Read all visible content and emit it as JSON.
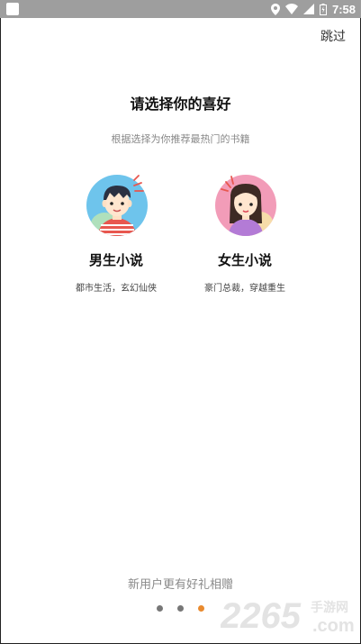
{
  "status_bar": {
    "time": "7:58"
  },
  "header": {
    "skip_label": "跳过"
  },
  "main": {
    "title": "请选择你的喜好",
    "subtitle": "根据选择为你推荐最热门的书籍",
    "options": [
      {
        "label": "男生小说",
        "tags": "都市生活，玄幻仙侠",
        "icon": "male-avatar-icon"
      },
      {
        "label": "女生小说",
        "tags": "豪门总裁，穿越重生",
        "icon": "female-avatar-icon"
      }
    ]
  },
  "footer": {
    "gift_text": "新用户更有好礼相赠",
    "pagination": {
      "total": 3,
      "active": 3
    }
  },
  "watermark": {
    "number": "2265",
    "suffix": "手游网",
    "domain": ".com"
  },
  "colors": {
    "status_bar": "#9e9e9e",
    "active_dot": "#e98a2e",
    "inactive_dot": "#777777",
    "male_circle": "#6ec4ec",
    "female_circle": "#f29cb8",
    "watermark": "#e3e3e3"
  }
}
